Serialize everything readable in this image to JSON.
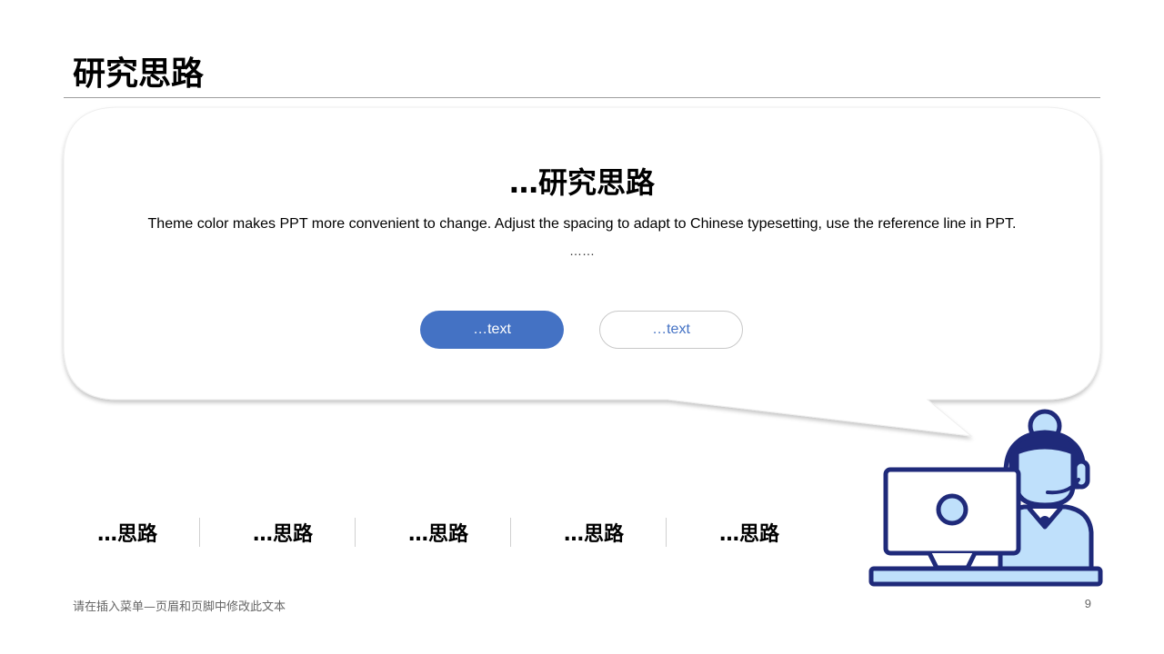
{
  "header": {
    "title": "研究思路"
  },
  "callout": {
    "heading": "…研究思路",
    "body": "Theme color makes PPT more convenient to change. Adjust the spacing to adapt to Chinese typesetting, use the reference line in PPT.",
    "ellipsis": "……",
    "primary_button": "…text",
    "secondary_button": "…text"
  },
  "nav_items": [
    {
      "label": "…思路"
    },
    {
      "label": "…思路"
    },
    {
      "label": "…思路"
    },
    {
      "label": "…思路"
    },
    {
      "label": "…思路"
    }
  ],
  "footer": {
    "text": "请在插入菜单—页眉和页脚中修改此文本",
    "page_number": "9"
  },
  "illustration": {
    "icon": "customer-service-agent-laptop-icon"
  },
  "colors": {
    "accent": "#4472c4",
    "navy": "#1f2a7a",
    "light_blue": "#bfe0fb",
    "divider": "#9e9e9e"
  }
}
